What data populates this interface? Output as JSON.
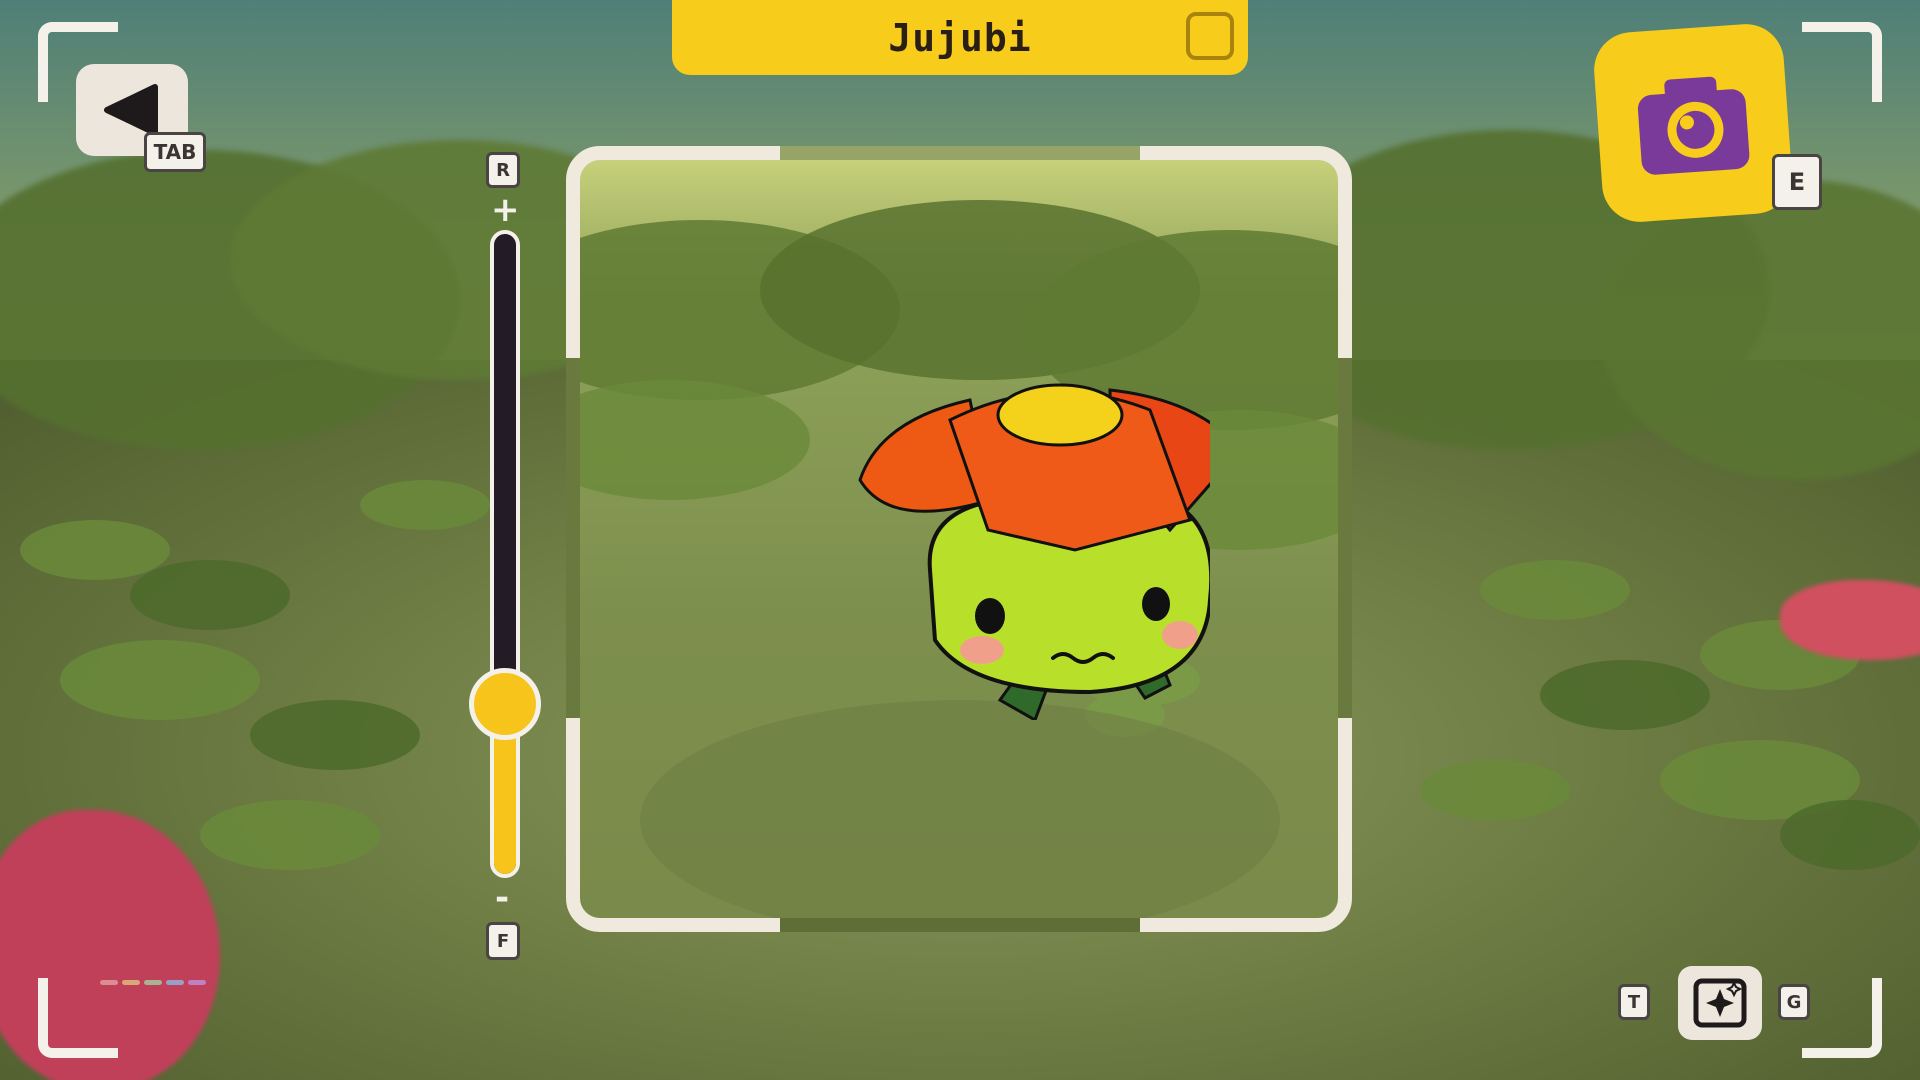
{
  "character": {
    "name": "Jujubi"
  },
  "controls": {
    "back_key": "TAB",
    "zoom_in_key": "R",
    "zoom_out_key": "F",
    "zoom_plus": "+",
    "zoom_minus": "-",
    "capture_key": "E",
    "filter_prev_key": "T",
    "filter_next_key": "G"
  },
  "zoom": {
    "level_fraction": 0.21
  },
  "colors": {
    "accent": "#f7cc1b",
    "frame": "#efe9de",
    "camera_icon": "#7a3a9a"
  },
  "icons": {
    "back": "play-left-triangle",
    "camera": "camera-icon",
    "filter": "sparkle-frame-icon"
  },
  "filter_dots": [
    "#e0a0a0",
    "#e0c080",
    "#a0d0a0",
    "#90b8e0",
    "#c090d8"
  ]
}
